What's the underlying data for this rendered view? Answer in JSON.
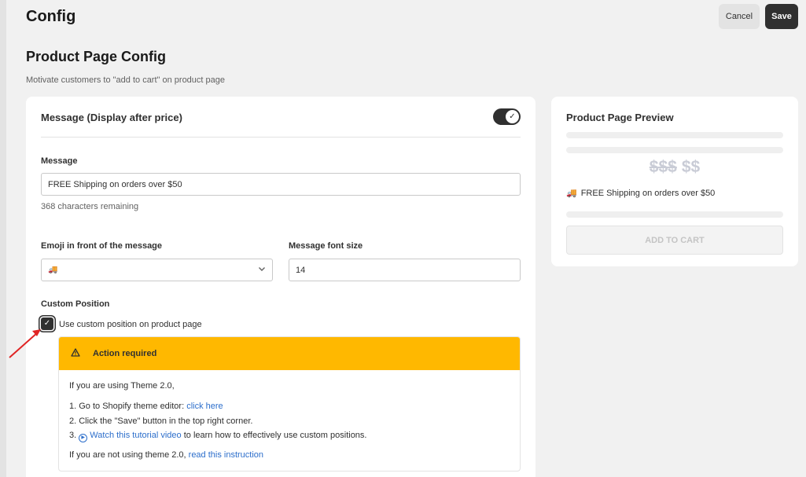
{
  "header": {
    "title": "Config",
    "cancel_label": "Cancel",
    "save_label": "Save"
  },
  "page": {
    "title": "Product Page Config",
    "subtitle": "Motivate customers to \"add to cart\" on product page"
  },
  "message_card": {
    "title": "Message (Display after price)",
    "toggle_on": true,
    "message_label": "Message",
    "message_value": "FREE Shipping on orders over $50",
    "chars_remaining": "368 characters remaining",
    "emoji_label": "Emoji in front of the message",
    "emoji_value": "🚚",
    "font_size_label": "Message font size",
    "font_size_value": "14",
    "custom_position_label": "Custom Position",
    "custom_position_checkbox_label": "Use custom position on product page",
    "custom_position_checked": true
  },
  "action_banner": {
    "title": "Action required",
    "intro": "If you are using Theme 2.0,",
    "step1_text": "1. Go to Shopify theme editor: ",
    "step1_link": "click here",
    "step2_text": "2. Click the \"Save\" button in the top right corner.",
    "step3_prefix": "3. ",
    "step3_link": "Watch this tutorial video",
    "step3_suffix": " to learn how to effectively use custom positions.",
    "outro_text": "If you are not using theme 2.0, ",
    "outro_link": "read this instruction",
    "accent_color": "#ffb800"
  },
  "preview": {
    "title": "Product Page Preview",
    "price_old": "$$$",
    "price_new": "$$",
    "emoji": "🚚",
    "message": "FREE Shipping on orders over $50",
    "add_to_cart": "ADD TO CART"
  },
  "icons": {
    "toggle_check": "check-icon",
    "select_chevron": "chevron-down-icon",
    "warning": "warning-icon",
    "play": "play-circle-icon",
    "truck": "truck-icon",
    "arrow": "red-arrow-icon"
  }
}
